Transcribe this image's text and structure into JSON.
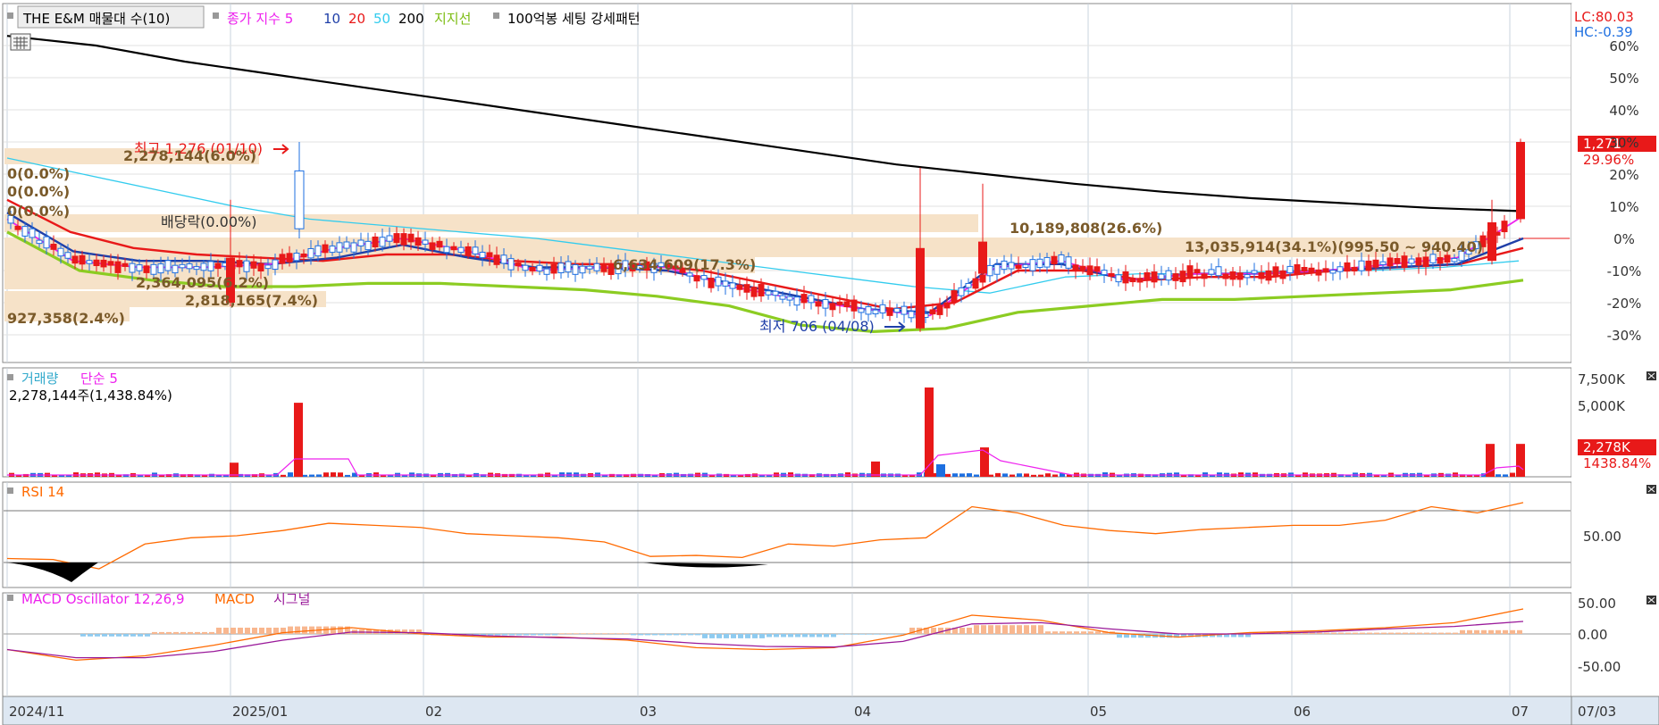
{
  "colors": {
    "black": "#000000",
    "magenta": "#ee22ee",
    "blue": "#1f3fa8",
    "red": "#e81919",
    "cyan": "#33ccee",
    "green": "#8ccc22",
    "zone": "#f6e2c8",
    "up": "#e81919",
    "down": "#1e6fe0",
    "rsi": "#ff6a00",
    "macd": "#ff6a00",
    "signal": "#9a1a9a",
    "osc_pos": "#f8b78f",
    "osc_neg": "#8ecbf0",
    "annot": "#7a5a2a",
    "axis_bg": "#dde7f2"
  },
  "legend": {
    "main": {
      "name": "THE E&M 매물대 수(10)",
      "ma_label": "종가 지수 5",
      "ma_10": "10",
      "ma_20": "20",
      "ma_50": "50",
      "ma_200": "200",
      "support": "지지선",
      "pattern": "100억봉 세팅 강세패턴"
    },
    "volume": {
      "name": "거래량",
      "ma": "단순 5",
      "value": "2,278,144주(1,438.84%)"
    },
    "rsi": {
      "name": "RSI 14"
    },
    "macd": {
      "name": "MACD Oscillator 12,26,9",
      "macd": "MACD",
      "signal": "시그널"
    }
  },
  "badges": {
    "lc": "LC:80.03",
    "hc": "HC:-0.39",
    "price": "1,271",
    "pct": "29.96%",
    "vol": "2,278K",
    "vol_pct": "1438.84%"
  },
  "annotations": {
    "high": "최고 1,276 (01/10)",
    "low": "최저 706 (04/08)",
    "dividend": "배당락(0.00%)",
    "z1": "2,278,144(6.0%)",
    "z2": "0(0.0%)",
    "z3": "0(0.0%)",
    "z4": "0(0.0%)",
    "z5": "10,189,808(26.6%)",
    "z6": "13,035,914(34.1%)(995.50 ~ 940.40)",
    "z7": "6,634,609(17.3%)",
    "z8": "2,364,095(6.2%)",
    "z9": "2,818,165(7.4%)",
    "z10": "927,358(2.4%)"
  },
  "axes": {
    "main_ticks": [
      "60%",
      "50%",
      "40%",
      "30%",
      "20%",
      "10%",
      "0%",
      "-10%",
      "-20%",
      "-30%"
    ],
    "volume_ticks": [
      "7,500K",
      "5,000K"
    ],
    "rsi_ticks": [
      "50.00"
    ],
    "macd_ticks": [
      "50.00",
      "0.00",
      "-50.00"
    ],
    "x_labels": [
      "2024/11",
      "2025/01",
      "02",
      "03",
      "04",
      "05",
      "06",
      "07"
    ],
    "x_right": "07/03"
  },
  "chart_data": {
    "type": "candlestick",
    "x_categories": [
      "2024/11",
      "2025/01",
      "02",
      "03",
      "04",
      "05",
      "06",
      "07"
    ],
    "high": {
      "value": 1276,
      "date": "01/10"
    },
    "low": {
      "value": 706,
      "date": "04/08"
    },
    "last_close": 1271,
    "last_change_pct": 29.96,
    "main_series_pct": {
      "ma200": [
        63,
        60,
        55,
        51,
        47,
        43,
        39,
        35,
        31,
        27,
        23,
        20,
        17,
        14.5,
        12.5,
        11,
        9.5,
        8.5
      ],
      "ma50": [
        25,
        20,
        15,
        10,
        6,
        4,
        2,
        0,
        -3,
        -6,
        -9,
        -12,
        -15,
        -17,
        -12,
        -11,
        -11,
        -10,
        -10,
        -9,
        -7
      ],
      "support": [
        2,
        -10,
        -13,
        -15,
        -15,
        -14,
        -14,
        -15,
        -16,
        -18,
        -21,
        -27,
        -29,
        -28,
        -23,
        -21,
        -19,
        -19,
        -18,
        -17,
        -16,
        -13
      ],
      "ma20": [
        12,
        2,
        -3,
        -5,
        -6,
        -7,
        -5,
        -5,
        -7,
        -8,
        -8,
        -10,
        -14,
        -18,
        -22,
        -20,
        -10,
        -10,
        -13,
        -12,
        -12,
        -10,
        -9,
        -8,
        -3
      ],
      "ma10": [
        8,
        -4,
        -7,
        -7,
        -8,
        -6,
        -2,
        -6,
        -9,
        -9,
        -10,
        -14,
        -18,
        -22,
        -23,
        -8,
        -8,
        -13,
        -11,
        -11,
        -10,
        -9,
        -8,
        0
      ],
      "ma5": [
        6,
        -7,
        -9,
        -9,
        -8,
        -3,
        0,
        -4,
        -10,
        -9,
        -9,
        -15,
        -19,
        -22,
        -24,
        -9,
        -7,
        -13,
        -11,
        -11,
        -10,
        -8,
        -6,
        7
      ]
    },
    "volume": {
      "last": 2278144,
      "last_pct": 1438.84,
      "ma": "단순 5",
      "spikes_k": [
        1200,
        6300,
        1300,
        7600,
        2500,
        2800,
        2800
      ]
    },
    "rsi": {
      "period": 14,
      "last": 80.03,
      "level_upper": 70,
      "level_lower": 30,
      "values": [
        28,
        27,
        18,
        42,
        48,
        50,
        55,
        62,
        60,
        58,
        52,
        50,
        48,
        44,
        30,
        31,
        29,
        42,
        40,
        46,
        48,
        78,
        72,
        60,
        55,
        52,
        56,
        58,
        60,
        60,
        65,
        78,
        72,
        82
      ]
    },
    "macd": {
      "params": "12,26,9",
      "macd": [
        -25,
        -42,
        -35,
        -18,
        2,
        10,
        0,
        -5,
        -5,
        -10,
        -22,
        -25,
        -22,
        -2,
        30,
        22,
        2,
        -5,
        2,
        5,
        10,
        18,
        40
      ],
      "signal": [
        -25,
        -38,
        -38,
        -28,
        -10,
        3,
        2,
        -3,
        -6,
        -8,
        -15,
        -20,
        -21,
        -12,
        16,
        18,
        8,
        0,
        0,
        3,
        8,
        12,
        20
      ]
    }
  }
}
